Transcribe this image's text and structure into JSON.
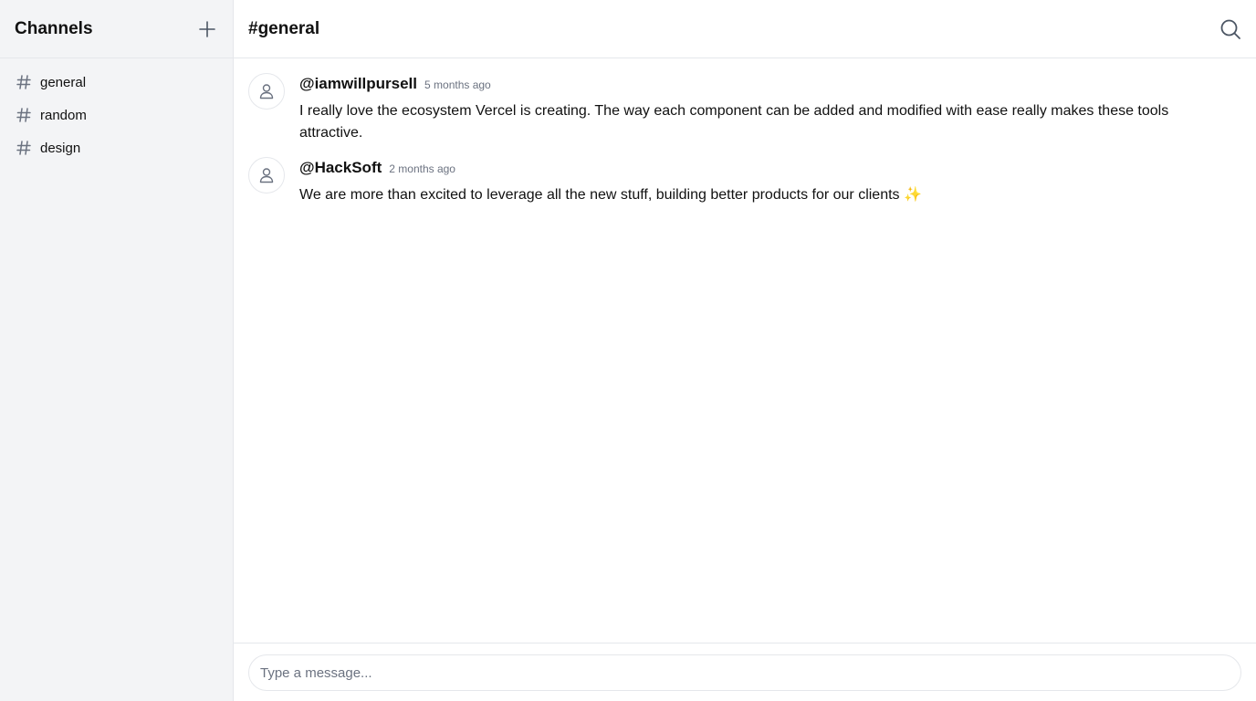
{
  "sidebar": {
    "title": "Channels",
    "add_icon": "plus-icon",
    "channels": [
      {
        "label": "general",
        "icon": "hash-icon"
      },
      {
        "label": "random",
        "icon": "hash-icon"
      },
      {
        "label": "design",
        "icon": "hash-icon"
      }
    ]
  },
  "header": {
    "channel_title": "#general",
    "search_icon": "search-icon"
  },
  "messages": [
    {
      "author": "@iamwillpursell",
      "time": "5 months ago",
      "text": "I really love the ecosystem Vercel is creating. The way each component can be added and modified with ease really makes these tools attractive.",
      "avatar_icon": "user-icon"
    },
    {
      "author": "@HackSoft",
      "time": "2 months ago",
      "text": "We are more than excited to leverage all the new stuff, building better products for our clients ✨",
      "avatar_icon": "user-icon"
    }
  ],
  "composer": {
    "placeholder": "Type a message..."
  },
  "colors": {
    "sidebar_bg": "#f3f4f6",
    "border": "#e5e7eb",
    "muted_text": "#6b7280",
    "text": "#111111",
    "icon": "#6b7280"
  }
}
